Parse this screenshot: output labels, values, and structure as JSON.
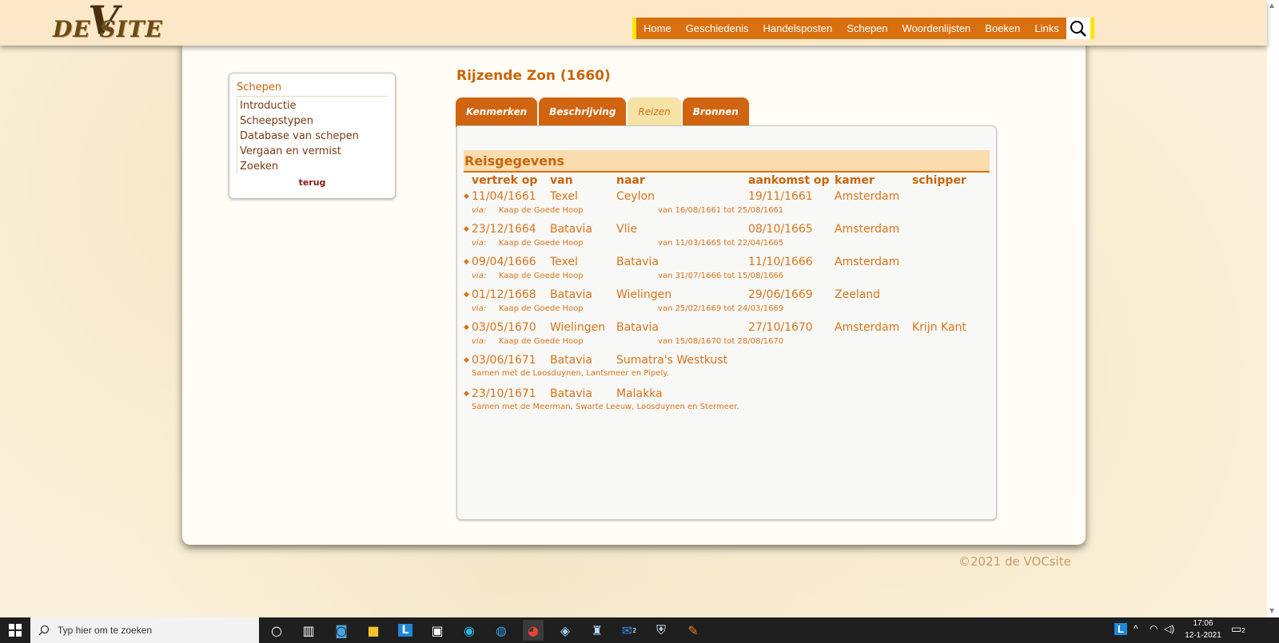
{
  "site": {
    "logo_text": "DE    SITE",
    "logo_v": "V",
    "nav": [
      "Home",
      "Geschiedenis",
      "Handelsposten",
      "Schepen",
      "Woordenlijsten",
      "Boeken",
      "Links"
    ]
  },
  "sidebar": {
    "title": "Schepen",
    "items": [
      "Introductie",
      "Scheepstypen",
      "Database van schepen",
      "Vergaan en vermist",
      "Zoeken"
    ],
    "back": "terug"
  },
  "page": {
    "title": "Rijzende Zon (1660)",
    "tabs": [
      "Kenmerken",
      "Beschrijving",
      "Reizen",
      "Bronnen"
    ],
    "active_tab": "Reizen",
    "section_title": "Reisgegevens",
    "columns": [
      "vertrek op",
      "van",
      "naar",
      "aankomst op",
      "kamer",
      "schipper"
    ],
    "voyages": [
      {
        "vertrek": "11/04/1661",
        "van": "Texel",
        "naar": "Ceylon",
        "aankomst": "19/11/1661",
        "kamer": "Amsterdam",
        "schipper": "",
        "via_label": "via:",
        "via": "Kaap de Goede Hoop",
        "via_dates": "van 16/08/1661 tot 25/08/1661",
        "note": ""
      },
      {
        "vertrek": "23/12/1664",
        "van": "Batavia",
        "naar": "Vlie",
        "aankomst": "08/10/1665",
        "kamer": "Amsterdam",
        "schipper": "",
        "via_label": "via:",
        "via": "Kaap de Goede Hoop",
        "via_dates": "van 11/03/1665 tot 22/04/1665",
        "note": ""
      },
      {
        "vertrek": "09/04/1666",
        "van": "Texel",
        "naar": "Batavia",
        "aankomst": "11/10/1666",
        "kamer": "Amsterdam",
        "schipper": "",
        "via_label": "via:",
        "via": "Kaap de Goede Hoop",
        "via_dates": "van 31/07/1666 tot 15/08/1666",
        "note": ""
      },
      {
        "vertrek": "01/12/1668",
        "van": "Batavia",
        "naar": "Wielingen",
        "aankomst": "29/06/1669",
        "kamer": "Zeeland",
        "schipper": "",
        "via_label": "via:",
        "via": "Kaap de Goede Hoop",
        "via_dates": "van 25/02/1669 tot 24/03/1669",
        "note": ""
      },
      {
        "vertrek": "03/05/1670",
        "van": "Wielingen",
        "naar": "Batavia",
        "aankomst": "27/10/1670",
        "kamer": "Amsterdam",
        "schipper": "Krijn Kant",
        "via_label": "via:",
        "via": "Kaap de Goede Hoop",
        "via_dates": "van 15/08/1670 tot 28/08/1670",
        "note": ""
      },
      {
        "vertrek": "03/06/1671",
        "van": "Batavia",
        "naar": "Sumatra's Westkust",
        "aankomst": "",
        "kamer": "",
        "schipper": "",
        "via_label": "",
        "via": "",
        "via_dates": "",
        "note": "Samen met de Loosduynen, Lantsmeer en Pipely."
      },
      {
        "vertrek": "23/10/1671",
        "van": "Batavia",
        "naar": "Malakka",
        "aankomst": "",
        "kamer": "",
        "schipper": "",
        "via_label": "",
        "via": "",
        "via_dates": "",
        "note": "Samen met de Meerman, Swarte Leeuw, Loosduynen en Stermeer."
      }
    ],
    "copyright": "©2021 de VOCsite"
  },
  "taskbar": {
    "search_placeholder": "Typ hier om te zoeken",
    "time": "17:06",
    "date": "12-1-2021",
    "mail_badge": "2",
    "notif_badge": "2"
  },
  "colors": {
    "accent": "#d9700f",
    "header_bg": "#fbe8c8",
    "text_orange": "#c8650a"
  }
}
